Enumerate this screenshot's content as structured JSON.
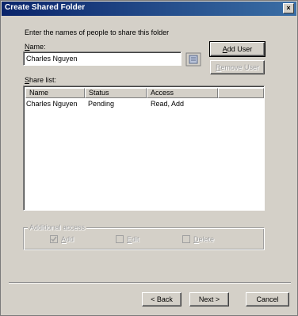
{
  "window": {
    "title": "Create Shared Folder",
    "close_glyph": "×"
  },
  "instructions": "Enter the names of people to share this folder",
  "name_field": {
    "label": "Name:",
    "value": "Charles Nguyen"
  },
  "buttons": {
    "add_user": "Add User",
    "remove_user": "Remove User",
    "back": "< Back",
    "next": "Next >",
    "cancel": "Cancel"
  },
  "share_list": {
    "label": "Share list:",
    "columns": [
      "Name",
      "Status",
      "Access"
    ],
    "rows": [
      [
        "Charles Nguyen",
        "Pending",
        "Read, Add"
      ]
    ]
  },
  "additional_access": {
    "label": "Additional access",
    "options": [
      {
        "label": "Add",
        "checked": true
      },
      {
        "label": "Edit",
        "checked": false
      },
      {
        "label": "Delete",
        "checked": false
      }
    ]
  }
}
